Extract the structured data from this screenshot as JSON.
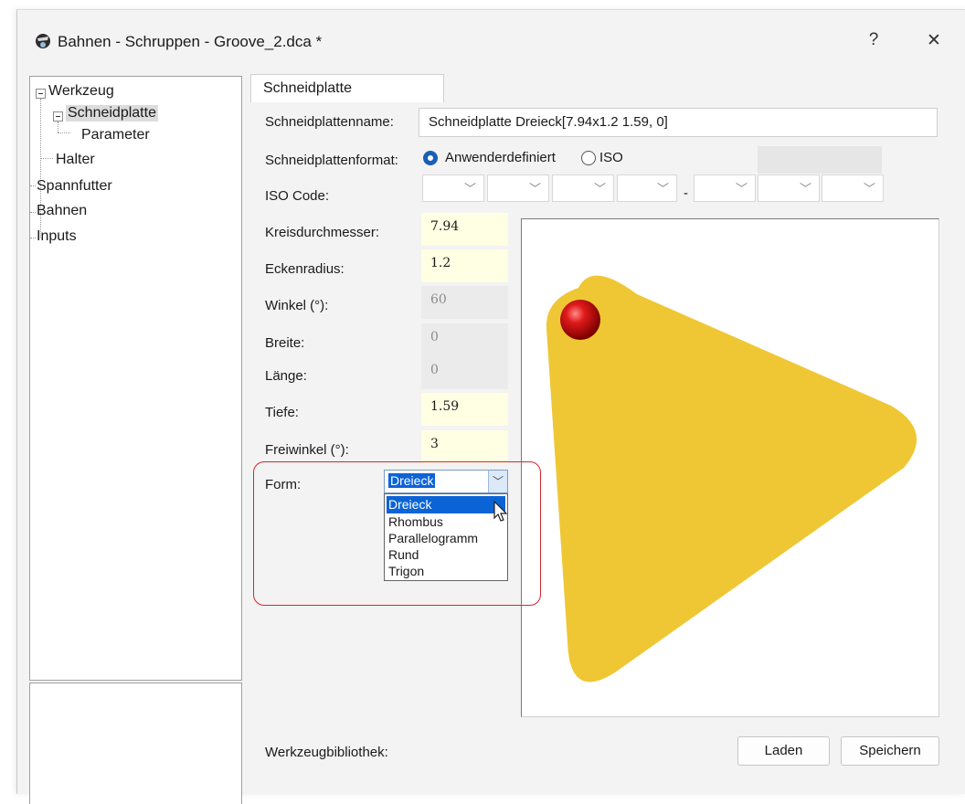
{
  "window": {
    "title": "Bahnen - Schruppen - Groove_2.dca *",
    "help_label": "?",
    "close_label": "✕"
  },
  "tree": {
    "items": [
      {
        "label": "Werkzeug"
      },
      {
        "label": "Schneidplatte"
      },
      {
        "label": "Parameter"
      },
      {
        "label": "Halter"
      },
      {
        "label": "Spannfutter"
      },
      {
        "label": "Bahnen"
      },
      {
        "label": "Inputs"
      }
    ]
  },
  "tab": {
    "label": "Schneidplatte"
  },
  "form": {
    "name_label": "Schneidplattenname:",
    "name_value": "Schneidplatte Dreieck[7.94x1.2 1.59, 0]",
    "format_label": "Schneidplattenformat:",
    "format_options": [
      "Anwenderdefiniert",
      "ISO"
    ],
    "format_selected": "Anwenderdefiniert",
    "iso_label": "ISO Code:",
    "iso_separator": "-",
    "kreis_label": "Kreisdurchmesser:",
    "kreis_value": "7.94",
    "ecken_label": "Eckenradius:",
    "ecken_value": "1.2",
    "winkel_label": "Winkel (°):",
    "winkel_value": "60",
    "breite_label": "Breite:",
    "breite_value": "0",
    "laenge_label": "Länge:",
    "laenge_value": "0",
    "tiefe_label": "Tiefe:",
    "tiefe_value": "1.59",
    "frei_label": "Freiwinkel  (°):",
    "frei_value": "3",
    "form_label": "Form:",
    "form_value": "Dreieck",
    "form_options": [
      "Dreieck",
      "Rhombus",
      "Parallelogramm",
      "Rund",
      "Trigon"
    ],
    "library_label": "Werkzeugbibliothek:",
    "load_label": "Laden",
    "save_label": "Speichern"
  },
  "colors": {
    "insert_fill": "#efc734",
    "marker": "#cc0000",
    "accent": "#0a64d6",
    "highlight_ring": "#d9252b"
  }
}
